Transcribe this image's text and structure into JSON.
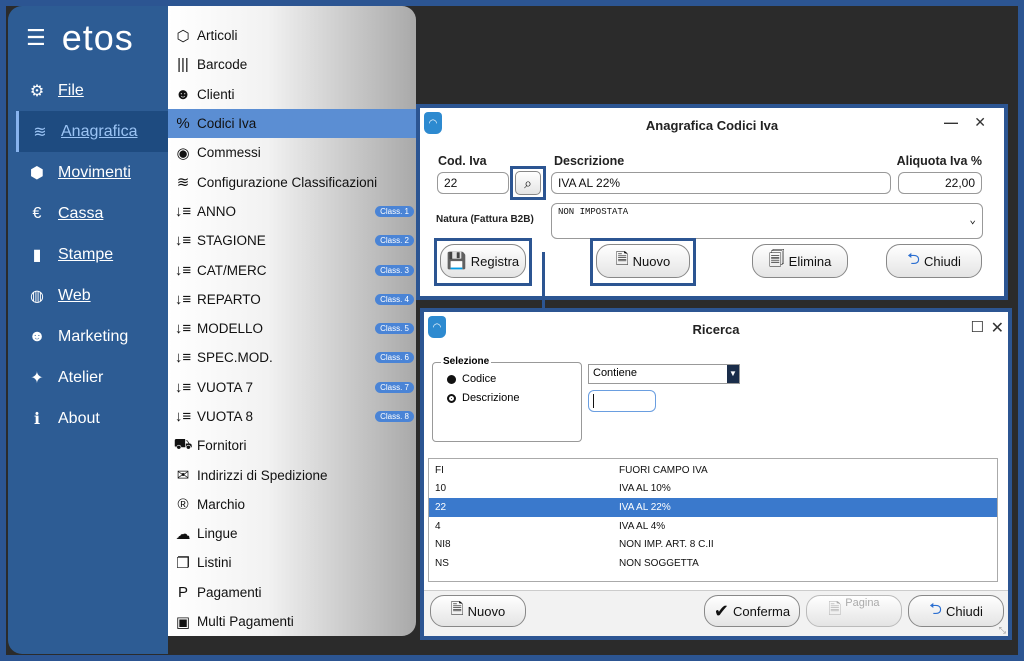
{
  "app": {
    "logo": "etos"
  },
  "nav": {
    "items": [
      {
        "icon": "⚙",
        "label": "File",
        "underline": true
      },
      {
        "icon": "≋",
        "label": "Anagrafica",
        "underline": true,
        "active": true
      },
      {
        "icon": "⬢",
        "label": "Movimenti",
        "underline": true
      },
      {
        "icon": "€",
        "label": "Cassa",
        "underline": true
      },
      {
        "icon": "▮",
        "label": "Stampe",
        "underline": true
      },
      {
        "icon": "◍",
        "label": "Web",
        "underline": true
      },
      {
        "icon": "☻",
        "label": "Marketing",
        "underline": false
      },
      {
        "icon": "✦",
        "label": "Atelier",
        "underline": false
      },
      {
        "icon": "ℹ",
        "label": "About",
        "underline": false
      }
    ]
  },
  "submenu": {
    "items": [
      {
        "icon": "⬡",
        "label": "Articoli"
      },
      {
        "icon": "|||",
        "label": "Barcode"
      },
      {
        "icon": "☻",
        "label": "Clienti"
      },
      {
        "icon": "%",
        "label": "Codici Iva",
        "active": true
      },
      {
        "icon": "◉",
        "label": "Commessi"
      },
      {
        "icon": "≋",
        "label": "Configurazione Classificazioni"
      },
      {
        "icon": "↓≡",
        "label": "ANNO",
        "badge": "Class. 1"
      },
      {
        "icon": "↓≡",
        "label": "STAGIONE",
        "badge": "Class. 2"
      },
      {
        "icon": "↓≡",
        "label": "CAT/MERC",
        "badge": "Class. 3"
      },
      {
        "icon": "↓≡",
        "label": "REPARTO",
        "badge": "Class. 4"
      },
      {
        "icon": "↓≡",
        "label": "MODELLO",
        "badge": "Class. 5"
      },
      {
        "icon": "↓≡",
        "label": "SPEC.MOD.",
        "badge": "Class. 6"
      },
      {
        "icon": "↓≡",
        "label": "VUOTA 7",
        "badge": "Class. 7"
      },
      {
        "icon": "↓≡",
        "label": "VUOTA 8",
        "badge": "Class. 8"
      },
      {
        "icon": "⛟",
        "label": "Fornitori"
      },
      {
        "icon": "✉",
        "label": "Indirizzi di Spedizione"
      },
      {
        "icon": "®",
        "label": "Marchio"
      },
      {
        "icon": "☁",
        "label": "Lingue"
      },
      {
        "icon": "❐",
        "label": "Listini"
      },
      {
        "icon": "P",
        "label": "Pagamenti"
      },
      {
        "icon": "▣",
        "label": "Multi Pagamenti"
      }
    ]
  },
  "anagrafica": {
    "title": "Anagrafica Codici Iva",
    "cod_label": "Cod. Iva",
    "cod_value": "22",
    "desc_label": "Descrizione",
    "desc_value": "IVA AL 22%",
    "aliquota_label": "Aliquota Iva %",
    "aliquota_value": "22,00",
    "natura_label": "Natura (Fattura B2B)",
    "natura_value": "NON IMPOSTATA",
    "btn_registra": "Registra",
    "btn_nuovo": "Nuovo",
    "btn_elimina": "Elimina",
    "btn_chiudi": "Chiudi"
  },
  "ricerca": {
    "title": "Ricerca",
    "selezione_label": "Selezione",
    "opt_codice": "Codice",
    "opt_descrizione": "Descrizione",
    "filter_value": "Contiene",
    "rows": [
      {
        "code": "FI",
        "desc": "FUORI CAMPO IVA"
      },
      {
        "code": "10",
        "desc": "IVA AL 10%"
      },
      {
        "code": "22",
        "desc": "IVA AL 22%",
        "selected": true
      },
      {
        "code": "4",
        "desc": "IVA AL 4%"
      },
      {
        "code": "NI8",
        "desc": "NON IMP. ART. 8 C.II"
      },
      {
        "code": "NS",
        "desc": "NON SOGGETTA"
      }
    ],
    "btn_nuovo": "Nuovo",
    "btn_conferma": "Conferma",
    "btn_pagina": "Pagina",
    "btn_chiudi": "Chiudi"
  }
}
